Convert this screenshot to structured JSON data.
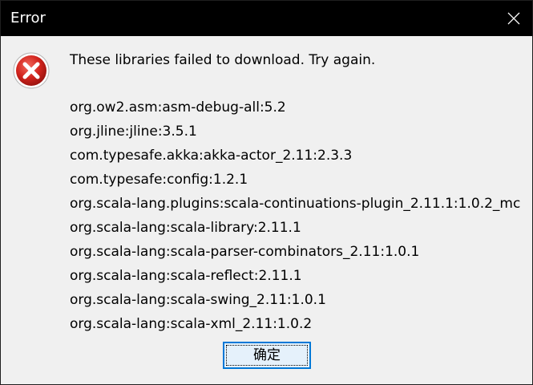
{
  "window": {
    "title": "Error",
    "close_icon": "close-icon"
  },
  "dialog": {
    "icon": "error-icon",
    "message": "These libraries failed to download. Try again.",
    "libraries": [
      "org.ow2.asm:asm-debug-all:5.2",
      "org.jline:jline:3.5.1",
      "com.typesafe.akka:akka-actor_2.11:2.3.3",
      "com.typesafe:config:1.2.1",
      "org.scala-lang.plugins:scala-continuations-plugin_2.11.1:1.0.2_mc",
      "org.scala-lang:scala-library:2.11.1",
      "org.scala-lang:scala-parser-combinators_2.11:1.0.1",
      "org.scala-lang:scala-reflect:2.11.1",
      "org.scala-lang:scala-swing_2.11:1.0.1",
      "org.scala-lang:scala-xml_2.11:1.0.2"
    ],
    "ok_label": "确定"
  },
  "colors": {
    "titlebar": "#000000",
    "title_text": "#ffffff",
    "background": "#f0f0f0",
    "error_red": "#c4201c",
    "button_border": "#0078d7",
    "button_fill": "#e5f1fb"
  }
}
